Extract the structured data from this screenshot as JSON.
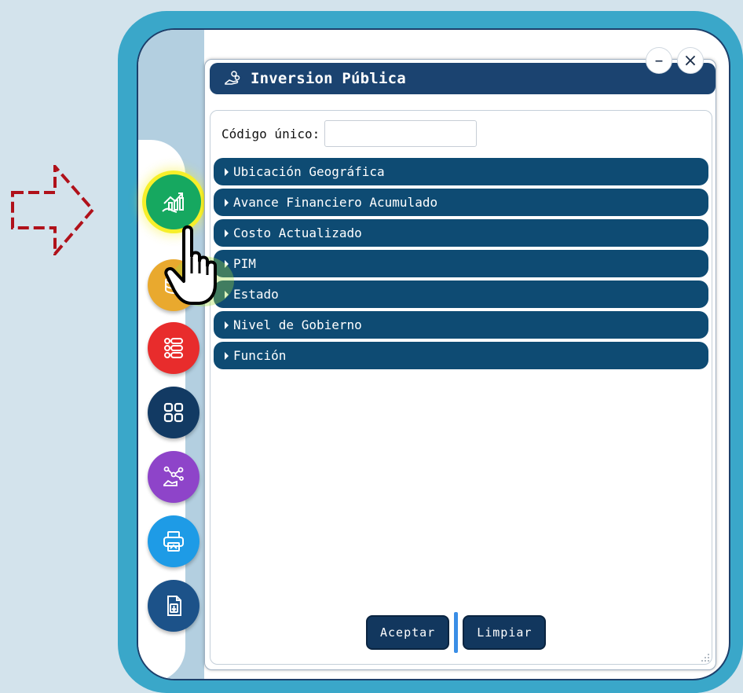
{
  "hint_arrow": {
    "icon": "dashed-arrow-right-icon",
    "color": "#b0111a"
  },
  "sidebar": {
    "buttons": [
      {
        "icon": "investment-chart-icon",
        "color": "#16a860",
        "highlighted": true,
        "highlight_color": "#f6ef2a"
      },
      {
        "icon": "coins-icon",
        "color": "#e9a92e"
      },
      {
        "icon": "list-icon",
        "color": "#e82c2c"
      },
      {
        "icon": "grid-icon",
        "color": "#123a63"
      },
      {
        "icon": "hand-network-icon",
        "color": "#8e44c9"
      },
      {
        "icon": "print-icon",
        "color": "#1e9be6"
      },
      {
        "icon": "export-document-icon",
        "color": "#1c5289"
      }
    ]
  },
  "dialog": {
    "title": "Inversion Pública",
    "title_icon": "hand-coins-icon",
    "minimize_label": "–",
    "close_label": "×",
    "code_label": "Código único:",
    "code_value": "",
    "code_placeholder": "",
    "sections": [
      {
        "label": "Ubicación Geográfica"
      },
      {
        "label": "Avance Financiero Acumulado"
      },
      {
        "label": "Costo Actualizado"
      },
      {
        "label": "PIM"
      },
      {
        "label": "Estado"
      },
      {
        "label": "Nivel de Gobierno"
      },
      {
        "label": "Función"
      }
    ],
    "accept_label": "Aceptar",
    "clear_label": "Limpiar"
  },
  "colors": {
    "frame": "#3aa7c9",
    "title_bar": "#1b4370",
    "section": "#0e4b73",
    "button": "#12375e"
  }
}
